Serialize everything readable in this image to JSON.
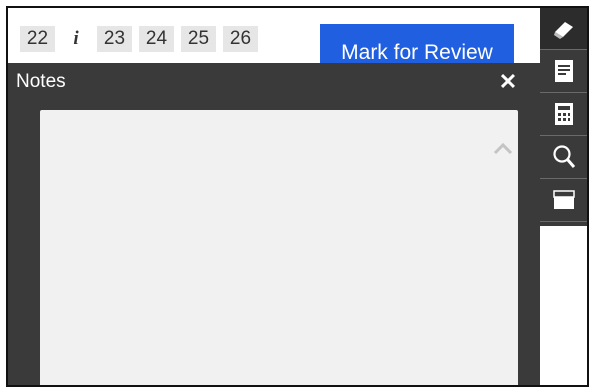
{
  "question_nav": {
    "items": [
      {
        "label": "22"
      },
      {
        "label": "i",
        "icon": "info-icon"
      },
      {
        "label": "23"
      },
      {
        "label": "24"
      },
      {
        "label": "25"
      },
      {
        "label": "26"
      }
    ]
  },
  "review": {
    "button_label": "Mark for Review"
  },
  "notes_panel": {
    "title": "Notes",
    "close_label": "✕",
    "text": ""
  },
  "toolbar": {
    "tools": [
      "eraser-icon",
      "notes-icon",
      "calculator-icon",
      "magnifier-icon",
      "line-reader-icon"
    ]
  },
  "colors": {
    "rail_background": "#3a3a3a",
    "notes_background": "#3a3a3a",
    "review_button": "#1f5fe0",
    "notes_area": "#f1f1f1"
  }
}
